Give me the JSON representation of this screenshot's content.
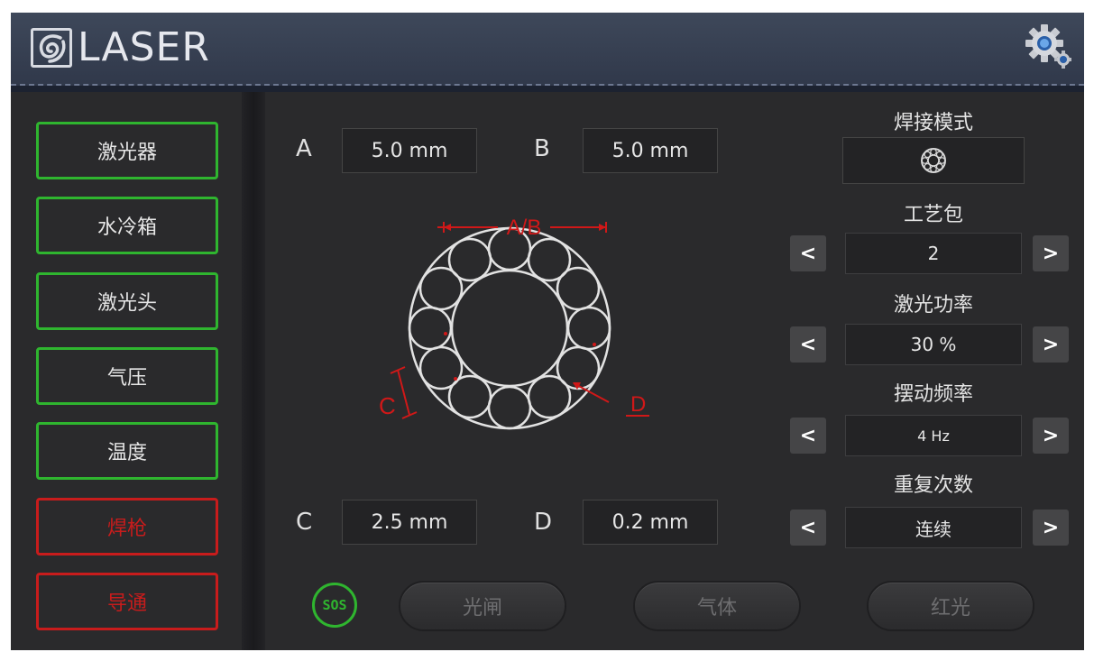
{
  "header": {
    "logo_text": "LASER"
  },
  "sidebar": {
    "items": [
      {
        "label": "激光器",
        "status": "ok"
      },
      {
        "label": "水冷箱",
        "status": "ok"
      },
      {
        "label": "激光头",
        "status": "ok"
      },
      {
        "label": "气压",
        "status": "ok"
      },
      {
        "label": "温度",
        "status": "ok"
      },
      {
        "label": "焊枪",
        "status": "fault"
      },
      {
        "label": "导通",
        "status": "fault"
      }
    ]
  },
  "params": {
    "a_label": "A",
    "a_value": "5.0 mm",
    "b_label": "B",
    "b_value": "5.0 mm",
    "c_label": "C",
    "c_value": "2.5 mm",
    "d_label": "D",
    "d_value": "0.2 mm"
  },
  "diagram": {
    "ab_label": "A/B",
    "c_label": "C",
    "d_label": "D"
  },
  "right_panel": {
    "mode_title": "焊接模式",
    "mode_icon": "ring-pattern-icon",
    "process_title": "工艺包",
    "process_value": "2",
    "power_title": "激光功率",
    "power_value": "30 %",
    "freq_title": "摆动频率",
    "freq_value": "4 Hz",
    "repeat_title": "重复次数",
    "repeat_value": "连续",
    "prev_glyph": "<",
    "next_glyph": ">"
  },
  "bottom": {
    "sos_label": "SOS",
    "shutter_label": "光闸",
    "gas_label": "气体",
    "red_light_label": "红光"
  },
  "colors": {
    "ok": "#2fb52f",
    "fault": "#c81c1c",
    "annotation": "#d01818"
  }
}
